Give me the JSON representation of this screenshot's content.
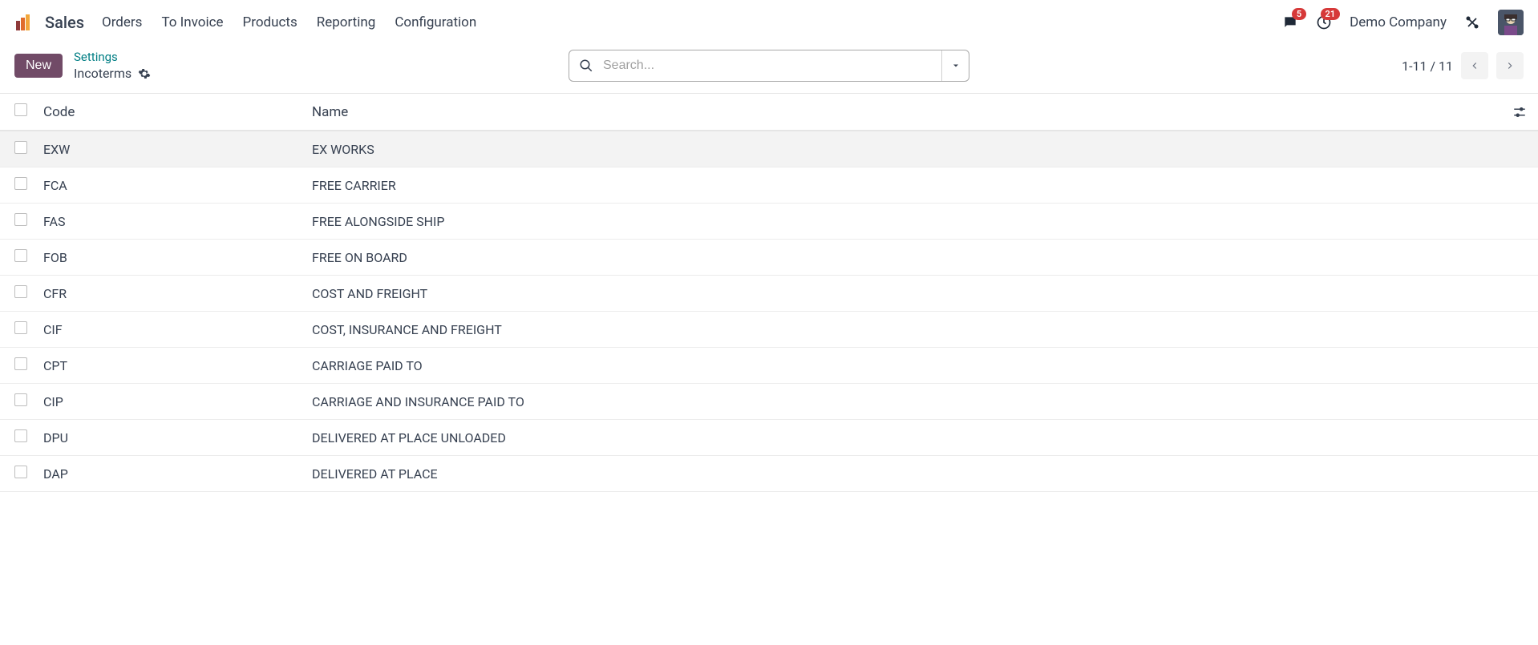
{
  "app": {
    "title": "Sales"
  },
  "nav": {
    "items": [
      {
        "label": "Orders"
      },
      {
        "label": "To Invoice"
      },
      {
        "label": "Products"
      },
      {
        "label": "Reporting"
      },
      {
        "label": "Configuration"
      }
    ]
  },
  "topbar": {
    "messages_count": "5",
    "activities_count": "21",
    "company": "Demo Company"
  },
  "controls": {
    "new_label": "New",
    "breadcrumb_parent": "Settings",
    "breadcrumb_current": "Incoterms",
    "search_placeholder": "Search...",
    "pager": "1-11 / 11"
  },
  "table": {
    "headers": {
      "code": "Code",
      "name": "Name"
    },
    "rows": [
      {
        "code": "EXW",
        "name": "EX WORKS",
        "highlight": true
      },
      {
        "code": "FCA",
        "name": "FREE CARRIER"
      },
      {
        "code": "FAS",
        "name": "FREE ALONGSIDE SHIP"
      },
      {
        "code": "FOB",
        "name": "FREE ON BOARD"
      },
      {
        "code": "CFR",
        "name": "COST AND FREIGHT"
      },
      {
        "code": "CIF",
        "name": "COST, INSURANCE AND FREIGHT"
      },
      {
        "code": "CPT",
        "name": "CARRIAGE PAID TO"
      },
      {
        "code": "CIP",
        "name": "CARRIAGE AND INSURANCE PAID TO"
      },
      {
        "code": "DPU",
        "name": "DELIVERED AT PLACE UNLOADED"
      },
      {
        "code": "DAP",
        "name": "DELIVERED AT PLACE"
      }
    ]
  }
}
